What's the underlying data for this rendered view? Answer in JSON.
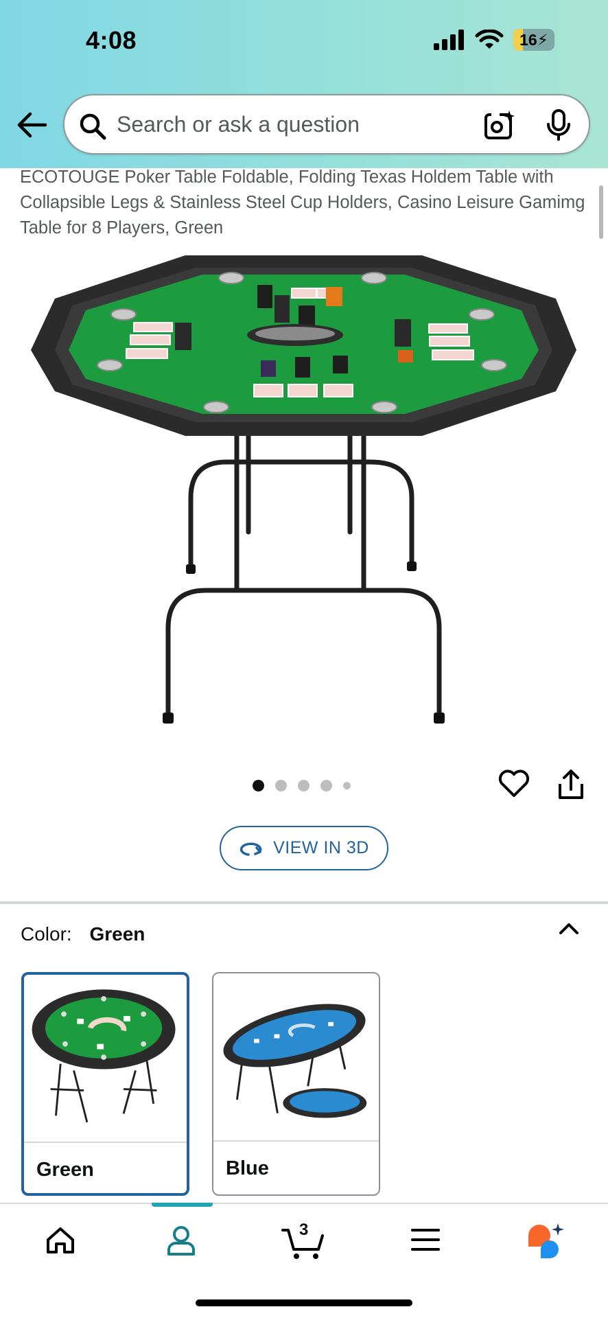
{
  "status_bar": {
    "time": "4:08",
    "battery": "16"
  },
  "search": {
    "placeholder": "Search or ask a question"
  },
  "product": {
    "title": "ECOTOUGE Poker Table Foldable, Folding Texas Holdem Table with Collapsible Legs & Stainless Steel Cup Holders, Casino Leisure Gamimg Table for 8 Players, Green",
    "image_count": 5,
    "active_image": 1,
    "view_3d_label": "VIEW IN 3D"
  },
  "variant": {
    "label": "Color:",
    "selected": "Green",
    "options": [
      {
        "name": "Green",
        "selected": true
      },
      {
        "name": "Blue",
        "selected": false
      }
    ]
  },
  "bottom_nav": {
    "items": [
      "home-icon",
      "account-icon",
      "cart-icon",
      "menu-icon",
      "rufus-icon"
    ],
    "cart_count": "3",
    "active": "account-icon"
  },
  "colors": {
    "accent": "#2162a1",
    "teal": "#22a4b4",
    "table_green": "#1c9b3f",
    "table_blue": "#2a8bd0"
  }
}
